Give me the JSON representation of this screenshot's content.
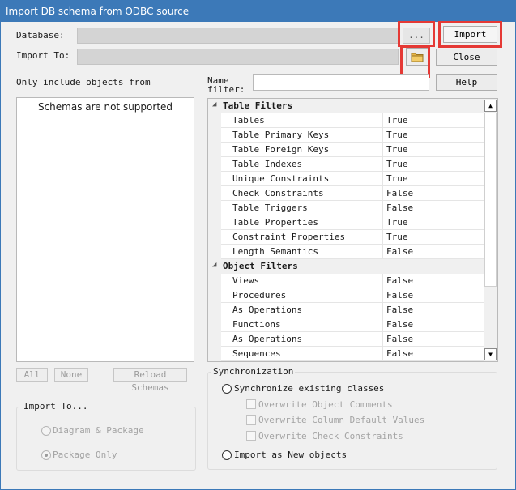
{
  "window": {
    "title": "Import DB schema from ODBC source"
  },
  "database": {
    "label": "Database:",
    "browse_label": "..."
  },
  "import_to": {
    "label": "Import To:",
    "folder_icon": "folder-icon"
  },
  "buttons": {
    "import": "Import",
    "close": "Close",
    "help": "Help"
  },
  "left": {
    "label": "Only include objects from",
    "message": "Schemas are not supported",
    "all": "All",
    "none": "None",
    "reload": "Reload Schemas"
  },
  "name_filter": {
    "label_line1": "Name",
    "label_line2": "filter:",
    "value": ""
  },
  "table_filters": {
    "title": "Table Filters",
    "rows": [
      {
        "name": "Tables",
        "value": "True"
      },
      {
        "name": "Table Primary Keys",
        "value": "True"
      },
      {
        "name": "Table Foreign Keys",
        "value": "True"
      },
      {
        "name": "Table Indexes",
        "value": "True"
      },
      {
        "name": "Unique Constraints",
        "value": "True"
      },
      {
        "name": "Check Constraints",
        "value": "False"
      },
      {
        "name": "Table Triggers",
        "value": "False"
      },
      {
        "name": "Table Properties",
        "value": "True"
      },
      {
        "name": "Constraint Properties",
        "value": "True"
      },
      {
        "name": "Length Semantics",
        "value": "False"
      }
    ]
  },
  "object_filters": {
    "title": "Object Filters",
    "rows": [
      {
        "name": "Views",
        "value": "False"
      },
      {
        "name": "Procedures",
        "value": "False"
      },
      {
        "name": "As Operations",
        "value": "False"
      },
      {
        "name": "Functions",
        "value": "False"
      },
      {
        "name": "As Operations",
        "value": "False"
      },
      {
        "name": "Sequences",
        "value": "False"
      }
    ]
  },
  "import_to_group": {
    "title": "Import To...",
    "diagram_package": "Diagram & Package",
    "package_only": "Package Only"
  },
  "synchronization": {
    "title": "Synchronization",
    "sync_existing": "Synchronize existing classes",
    "overwrite_comments": "Overwrite Object Comments",
    "overwrite_defaults": "Overwrite Column Default Values",
    "overwrite_checks": "Overwrite Check Constraints",
    "import_new": "Import as New objects"
  },
  "colors": {
    "titlebar": "#3c79b8",
    "highlight": "#e53935",
    "dialog_bg": "#f0f0f0"
  }
}
